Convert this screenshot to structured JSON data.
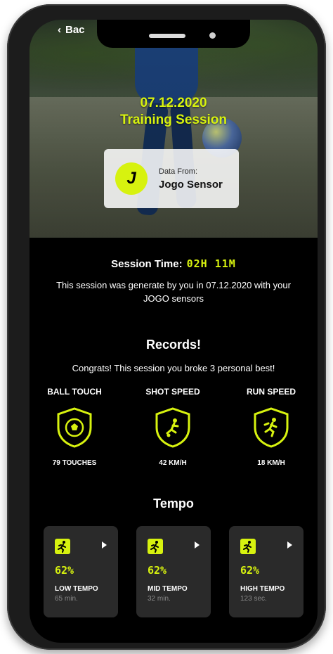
{
  "header": {
    "back_label": "Bac"
  },
  "hero": {
    "date": "07.12.2020",
    "title": "Training Session",
    "data_card": {
      "logo_letter": "J",
      "label": "Data From:",
      "source": "Jogo Sensor"
    }
  },
  "session": {
    "label": "Session Time:",
    "value": "02H 11M",
    "description": "This session was generate by you in 07.12.2020 with your JOGO sensors"
  },
  "records": {
    "title": "Records!",
    "subtitle": "Congrats! This session you broke 3 personal best!",
    "items": [
      {
        "name": "BALL TOUCH",
        "value": "79 TOUCHES",
        "icon": "soccer-ball-icon"
      },
      {
        "name": "SHOT SPEED",
        "value": "42 KM/H",
        "icon": "kick-icon"
      },
      {
        "name": "RUN SPEED",
        "value": "18 KM/H",
        "icon": "running-icon"
      }
    ]
  },
  "tempo": {
    "title": "Tempo",
    "cards": [
      {
        "percent": "62%",
        "name": "LOW TEMPO",
        "duration": "65 min."
      },
      {
        "percent": "62%",
        "name": "MID TEMPO",
        "duration": "32 min."
      },
      {
        "percent": "62%",
        "name": "HIGH TEMPO",
        "duration": "123 sec."
      }
    ]
  },
  "colors": {
    "accent": "#d7f20f",
    "background": "#000000",
    "card": "#2a2a2a"
  }
}
